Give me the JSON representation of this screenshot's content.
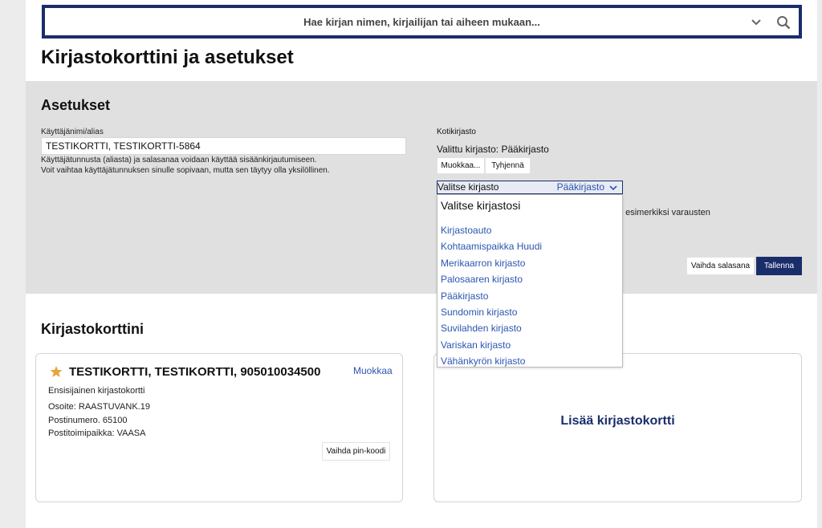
{
  "search": {
    "placeholder": "Hae kirjan nimen, kirjailijan tai aiheen mukaan..."
  },
  "page_title": "Kirjastokorttini ja asetukset",
  "settings": {
    "title": "Asetukset",
    "username_label": "Käyttäjänimi/alias",
    "username_value": "TESTIKORTTI, TESTIKORTTI-5864",
    "help_line1": "Käyttäjätunnusta (aliasta) ja salasanaa voidaan käyttää sisäänkirjautumiseen.",
    "help_line2": "Voit vaihtaa käyttäjätunnuksen sinulle sopivaan, mutta sen täytyy olla yksilöllinen.",
    "home_library_label": "Kotikirjasto",
    "selected_library": "Valittu kirjasto: Pääkirjasto",
    "edit_button": "Muokkaa...",
    "clear_button": "Tyhjennä",
    "select_placeholder": "Valitse kirjasto",
    "select_value": "Pääkirjasto",
    "partial_text": "lla, esimerkiksi varausten",
    "change_password_button": "Vaihda salasana",
    "save_button": "Tallenna"
  },
  "dropdown": {
    "heading": "Valitse kirjastosi",
    "options": [
      "Kirjastoauto",
      "Kohtaamispaikka Huudi",
      "Merikaarron kirjasto",
      "Palosaaren kirjasto",
      "Pääkirjasto",
      "Sundomin kirjasto",
      "Suvilahden kirjasto",
      "Variskan kirjasto",
      "Vähänkyrön kirjasto"
    ]
  },
  "cards": {
    "title": "Kirjastokorttini",
    "card_name": "TESTIKORTTI, TESTIKORTTI, 905010034500",
    "edit_link": "Muokkaa",
    "primary": "Ensisijainen kirjastokortti",
    "address": "Osoite: RAASTUVANK.19",
    "postal_code": "Postinumero. 65100",
    "city": "Postitoimipaikka: VAASA",
    "pin_button": "Vaihda pin-koodi",
    "add_card": "Lisää kirjastokortti"
  },
  "icons": {
    "chevron": "chevron-down-icon",
    "search": "search-icon",
    "star": "star-icon"
  },
  "colors": {
    "brand": "#1a2d6b",
    "link": "#2c55b0",
    "star": "#e8a33d"
  }
}
